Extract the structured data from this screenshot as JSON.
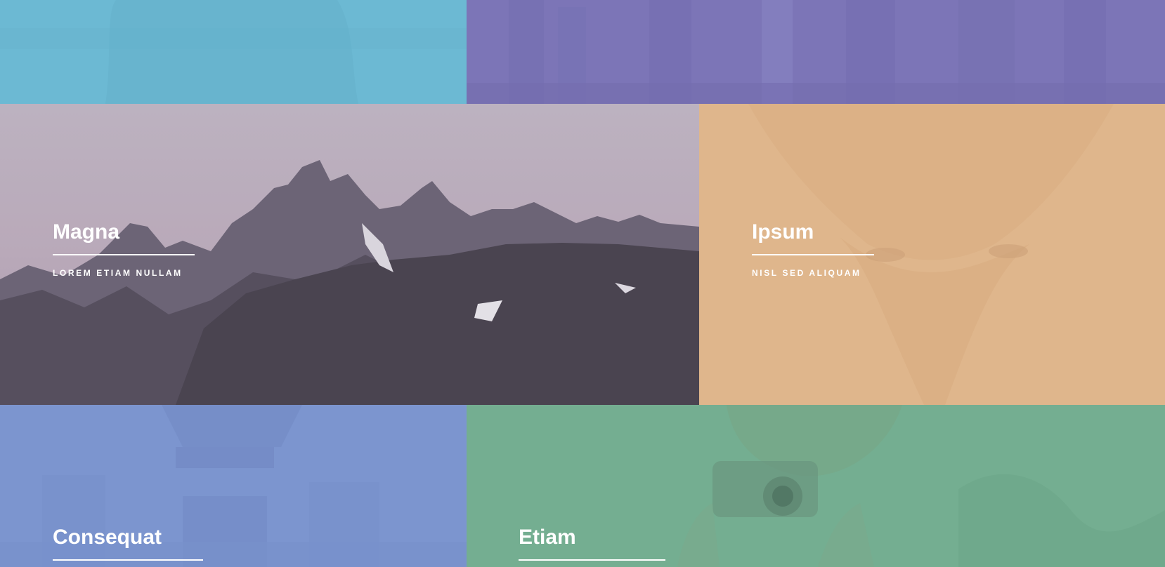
{
  "tiles": {
    "top_left": {
      "color": "#6fbdd6"
    },
    "top_right": {
      "color": "#7f78b9"
    },
    "magna": {
      "title": "Magna",
      "subtitle": "Lorem etiam nullam"
    },
    "ipsum": {
      "title": "Ipsum",
      "subtitle": "Nisl sed aliquam",
      "color": "#e0b78c"
    },
    "consequat": {
      "title": "Consequat",
      "color": "#7d96cf"
    },
    "etiam": {
      "title": "Etiam",
      "color": "#74b093"
    }
  }
}
